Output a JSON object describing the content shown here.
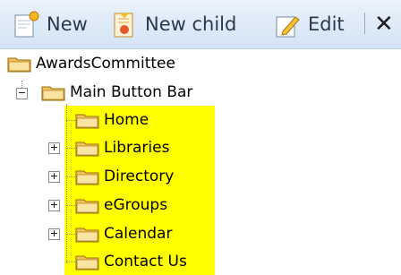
{
  "toolbar": {
    "new_label": "New",
    "new_child_label": "New child",
    "edit_label": "Edit",
    "close_glyph": "✕",
    "icons": {
      "new": "new-page-icon",
      "new_child": "new-child-icon",
      "edit": "edit-pencil-icon",
      "close": "close-icon"
    }
  },
  "tree": {
    "root": {
      "label": "AwardsCommittee"
    },
    "main": {
      "label": "Main Button Bar",
      "toggle": "−"
    },
    "children": [
      {
        "label": "Home",
        "toggle": ""
      },
      {
        "label": "Libraries",
        "toggle": "+"
      },
      {
        "label": "Directory",
        "toggle": "+"
      },
      {
        "label": "eGroups",
        "toggle": "+"
      },
      {
        "label": "Calendar",
        "toggle": "+"
      },
      {
        "label": "Contact Us",
        "toggle": ""
      }
    ]
  },
  "colors": {
    "highlight": "#ffff00",
    "folder": "#f2c96a",
    "toolbar_top": "#eaf2fb",
    "toolbar_bottom": "#d4e3f4"
  }
}
